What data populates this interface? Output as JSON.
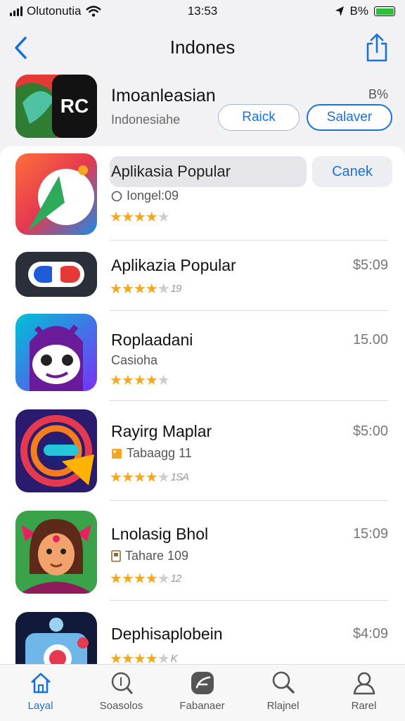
{
  "status_bar": {
    "carrier": "Olutonutia",
    "time": "13:53",
    "battery": "B%"
  },
  "nav": {
    "title": "Indones"
  },
  "hero": {
    "name": "Imoanleasian",
    "subtitle": "Indonesiahe",
    "percent": "B%",
    "icon_text": "RC",
    "btn_left": "Raick",
    "btn_right": "Salaver"
  },
  "search": {
    "value": "Aplikasia Popular",
    "cancel": "Canek"
  },
  "apps": [
    {
      "subtitle": "Iongel:09",
      "sub_icon": "circle-icon",
      "rating": 4.5,
      "count": ""
    },
    {
      "title": "Aplikazia Popular",
      "price": "$5:09",
      "rating": 4.5,
      "count": "19"
    },
    {
      "title": "Roplaadani",
      "subtitle": "Casioha",
      "price": "15.00",
      "rating": 4.5,
      "count": ""
    },
    {
      "title": "Rayirg Maplar",
      "subtitle": "Tabaagg 11",
      "sub_icon": "tag-icon",
      "price": "$5:00",
      "rating": 4.5,
      "count": "1SA"
    },
    {
      "title": "Lnolasig Bhol",
      "subtitle": "Tahare 109",
      "sub_icon": "doc-icon",
      "price": "15:09",
      "rating": 4.5,
      "count": "12"
    },
    {
      "title": "Dephisaplobein",
      "price": "$4:09",
      "rating": 4.5,
      "count": "K"
    }
  ],
  "tabs": [
    {
      "label": "Layal",
      "icon": "home-icon",
      "active": true
    },
    {
      "label": "Soasolos",
      "icon": "search-icon"
    },
    {
      "label": "Fabanaer",
      "icon": "apps-icon"
    },
    {
      "label": "Rlajnel",
      "icon": "search-icon"
    },
    {
      "label": "Rarel",
      "icon": "person-icon"
    }
  ],
  "colors": {
    "accent": "#1a72d8",
    "star": "#f5a623",
    "battery": "#2fbf3b"
  }
}
